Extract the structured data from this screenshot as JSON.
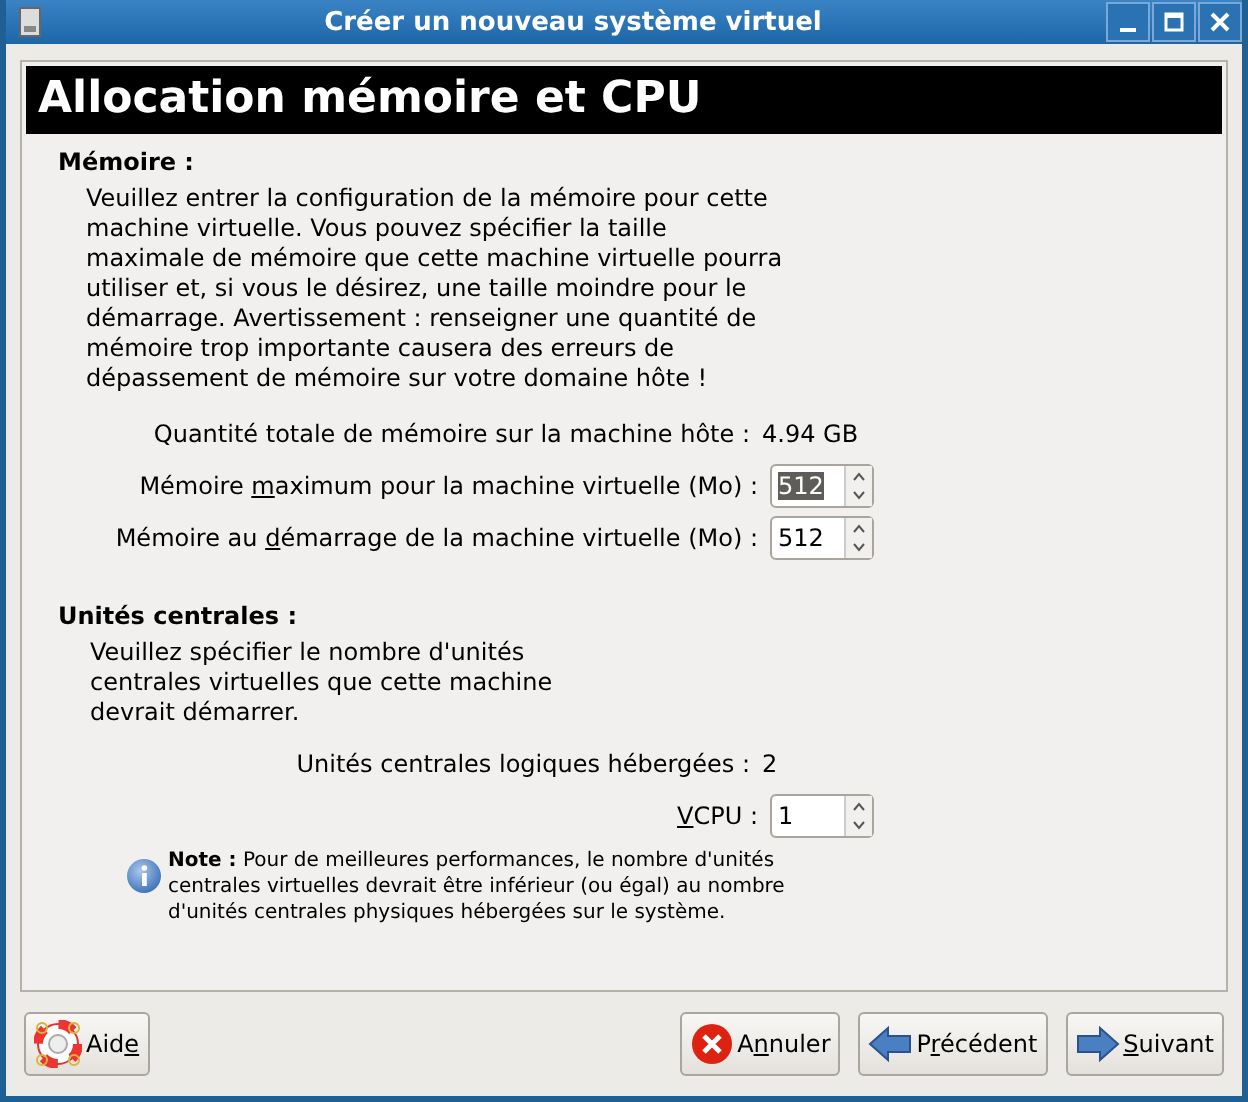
{
  "window": {
    "title": "Créer un nouveau système virtuel"
  },
  "header": {
    "title": "Allocation mémoire et CPU"
  },
  "memory": {
    "heading": "Mémoire :",
    "description": "Veuillez entrer la configuration de la mémoire pour cette machine virtuelle. Vous pouvez spécifier la taille maximale de mémoire que cette machine virtuelle pourra utiliser et, si vous le désirez, une taille moindre pour le démarrage. Avertissement : renseigner une quantité de mémoire trop importante causera des erreurs de dépassement de mémoire sur votre domaine hôte !",
    "rows": [
      {
        "kind": "info",
        "label": {
          "before": "Quantité totale de mémoire sur la machine hôte :"
        },
        "value": "4.94 GB"
      },
      {
        "kind": "spin",
        "label": {
          "before": "Mémoire ",
          "key": "m",
          "after": "aximum pour la machine virtuelle (Mo) :"
        },
        "value": "512",
        "selected": true
      },
      {
        "kind": "spin",
        "label": {
          "before": "Mémoire au ",
          "key": "d",
          "after": "émarrage de la machine virtuelle (Mo) :"
        },
        "value": "512",
        "selected": false
      }
    ]
  },
  "cpu": {
    "heading": "Unités centrales :",
    "description": "Veuillez spécifier le nombre d'unités centrales virtuelles que cette machine devrait démarrer.",
    "rows": [
      {
        "kind": "info",
        "label": {
          "before": "Unités centrales logiques hébergées :"
        },
        "value": "2"
      },
      {
        "kind": "spin",
        "label": {
          "key": "V",
          "after": "CPU :"
        },
        "value": "1",
        "selected": false
      }
    ],
    "note": "**Note :** Pour de meilleures performances, le nombre d'unités centrales virtuelles devrait être inférieur (ou égal) au nombre d'unités centrales physiques hébergées sur le système."
  },
  "buttons": [
    {
      "kind": "help",
      "label": {
        "before": "Aid",
        "key": "e"
      }
    },
    {
      "kind": "cancel",
      "label": {
        "before": "A",
        "key": "n",
        "after": "nuler"
      }
    },
    {
      "kind": "back",
      "label": {
        "before": "P",
        "key": "r",
        "after": "écédent"
      }
    },
    {
      "kind": "forward",
      "label": {
        "key": "S",
        "after": "uivant"
      }
    }
  ]
}
